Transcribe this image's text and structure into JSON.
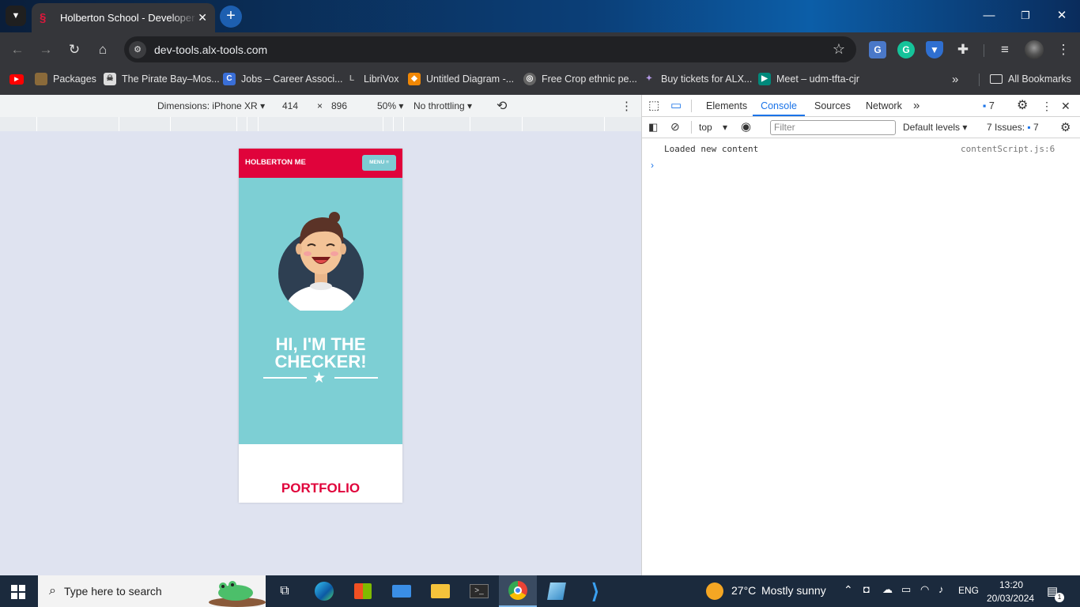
{
  "browser": {
    "tab_title": "Holberton School - Developer tools",
    "url": "dev-tools.alx-tools.com",
    "bookmarks": [
      {
        "label": "",
        "icon": "youtube-icon"
      },
      {
        "label": "Packages",
        "icon": "packages-icon"
      },
      {
        "label": "The Pirate Bay–Mos...",
        "icon": "pirate-bay-icon"
      },
      {
        "label": "Jobs – Career Associ...",
        "icon": "jobs-icon"
      },
      {
        "label": "LibriVox",
        "icon": "librivox-icon"
      },
      {
        "label": "Untitled Diagram -...",
        "icon": "diagram-icon"
      },
      {
        "label": "Free Crop ethnic pe...",
        "icon": "globe-icon"
      },
      {
        "label": "Buy tickets for ALX...",
        "icon": "tickets-icon"
      },
      {
        "label": "Meet – udm-tfta-cjr",
        "icon": "meet-icon"
      }
    ],
    "all_bookmarks": "All Bookmarks"
  },
  "device_toolbar": {
    "dimensions": "Dimensions: iPhone XR",
    "width": "414",
    "times": "×",
    "height": "896",
    "zoom": "50%",
    "throttling": "No throttling"
  },
  "page": {
    "brand": "HOLBERTON ME",
    "menu": "MENU ≡",
    "headline_1": "HI, I'M THE",
    "headline_2": "CHECKER!",
    "portfolio": "PORTFOLIO",
    "colors": {
      "header": "#e0033b",
      "hero": "#7dcfd4",
      "accent": "#e0033b"
    }
  },
  "devtools": {
    "tabs": [
      "Elements",
      "Console",
      "Sources",
      "Network"
    ],
    "active_tab": "Console",
    "issues_badge": "7",
    "context": "top",
    "filter_placeholder": "Filter",
    "levels": "Default levels",
    "issues_label": "7 Issues:",
    "issues_count": "7",
    "log_message": "Loaded new content",
    "log_source": "contentScript.js:6"
  },
  "taskbar": {
    "search_placeholder": "Type here to search",
    "weather_temp": "27°C",
    "weather_desc": "Mostly sunny",
    "language": "ENG",
    "time": "13:20",
    "date": "20/03/2024",
    "notifications": "1"
  }
}
